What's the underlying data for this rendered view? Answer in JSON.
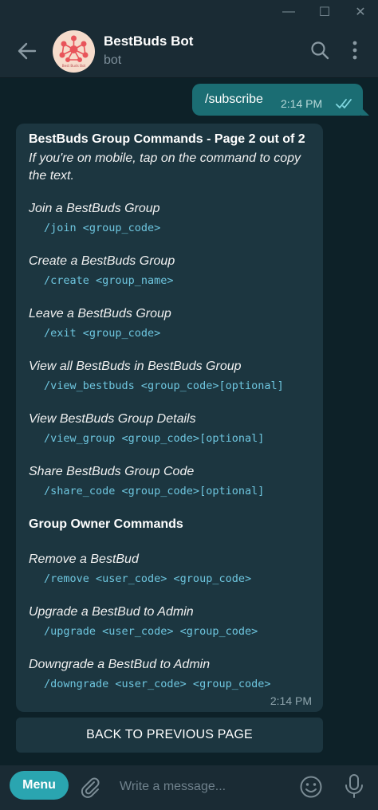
{
  "window": {
    "minimize_glyph": "—",
    "maximize_glyph": "☐",
    "close_glyph": "✕"
  },
  "header": {
    "title": "BestBuds Bot",
    "subtitle": "bot",
    "avatar_icon": "bestbuds-logo",
    "avatar_caption": "Best Buds Bot"
  },
  "outgoing": {
    "text": "/subscribe",
    "time": "2:14 PM",
    "status": "read"
  },
  "incoming": {
    "title": "BestBuds Group Commands - Page 2 out of 2",
    "note": "If you're on mobile, tap on the command to copy the text.",
    "commands": [
      {
        "title": "Join a BestBuds Group",
        "code": "/join <group_code>"
      },
      {
        "title": "Create a BestBuds Group",
        "code": "/create <group_name>"
      },
      {
        "title": "Leave a BestBuds Group",
        "code": "/exit <group_code>"
      },
      {
        "title": "View all BestBuds in BestBuds Group",
        "code": "/view_bestbuds <group_code>[optional]"
      },
      {
        "title": "View BestBuds Group Details",
        "code": "/view_group <group_code>[optional]"
      },
      {
        "title": "Share BestBuds Group Code",
        "code": "/share_code <group_code>[optional]"
      }
    ],
    "owner_section": "Group Owner Commands",
    "owner_commands": [
      {
        "title": "Remove a BestBud",
        "code": "/remove <user_code> <group_code>"
      },
      {
        "title": "Upgrade a BestBud to Admin",
        "code": "/upgrade <user_code> <group_code>"
      },
      {
        "title": "Downgrade a BestBud to Admin",
        "code": "/downgrade <user_code> <group_code>"
      }
    ],
    "time": "2:14 PM"
  },
  "inline_button": {
    "label": "BACK TO PREVIOUS PAGE"
  },
  "composer": {
    "menu_label": "Menu",
    "placeholder": "Write a message..."
  },
  "colors": {
    "header_bg": "#1a2b34",
    "chat_bg": "#0d2128",
    "outgoing_bubble": "#1b6d73",
    "incoming_bubble": "#1c3640",
    "accent": "#2aa5b0",
    "code_text": "#6ec6df"
  }
}
